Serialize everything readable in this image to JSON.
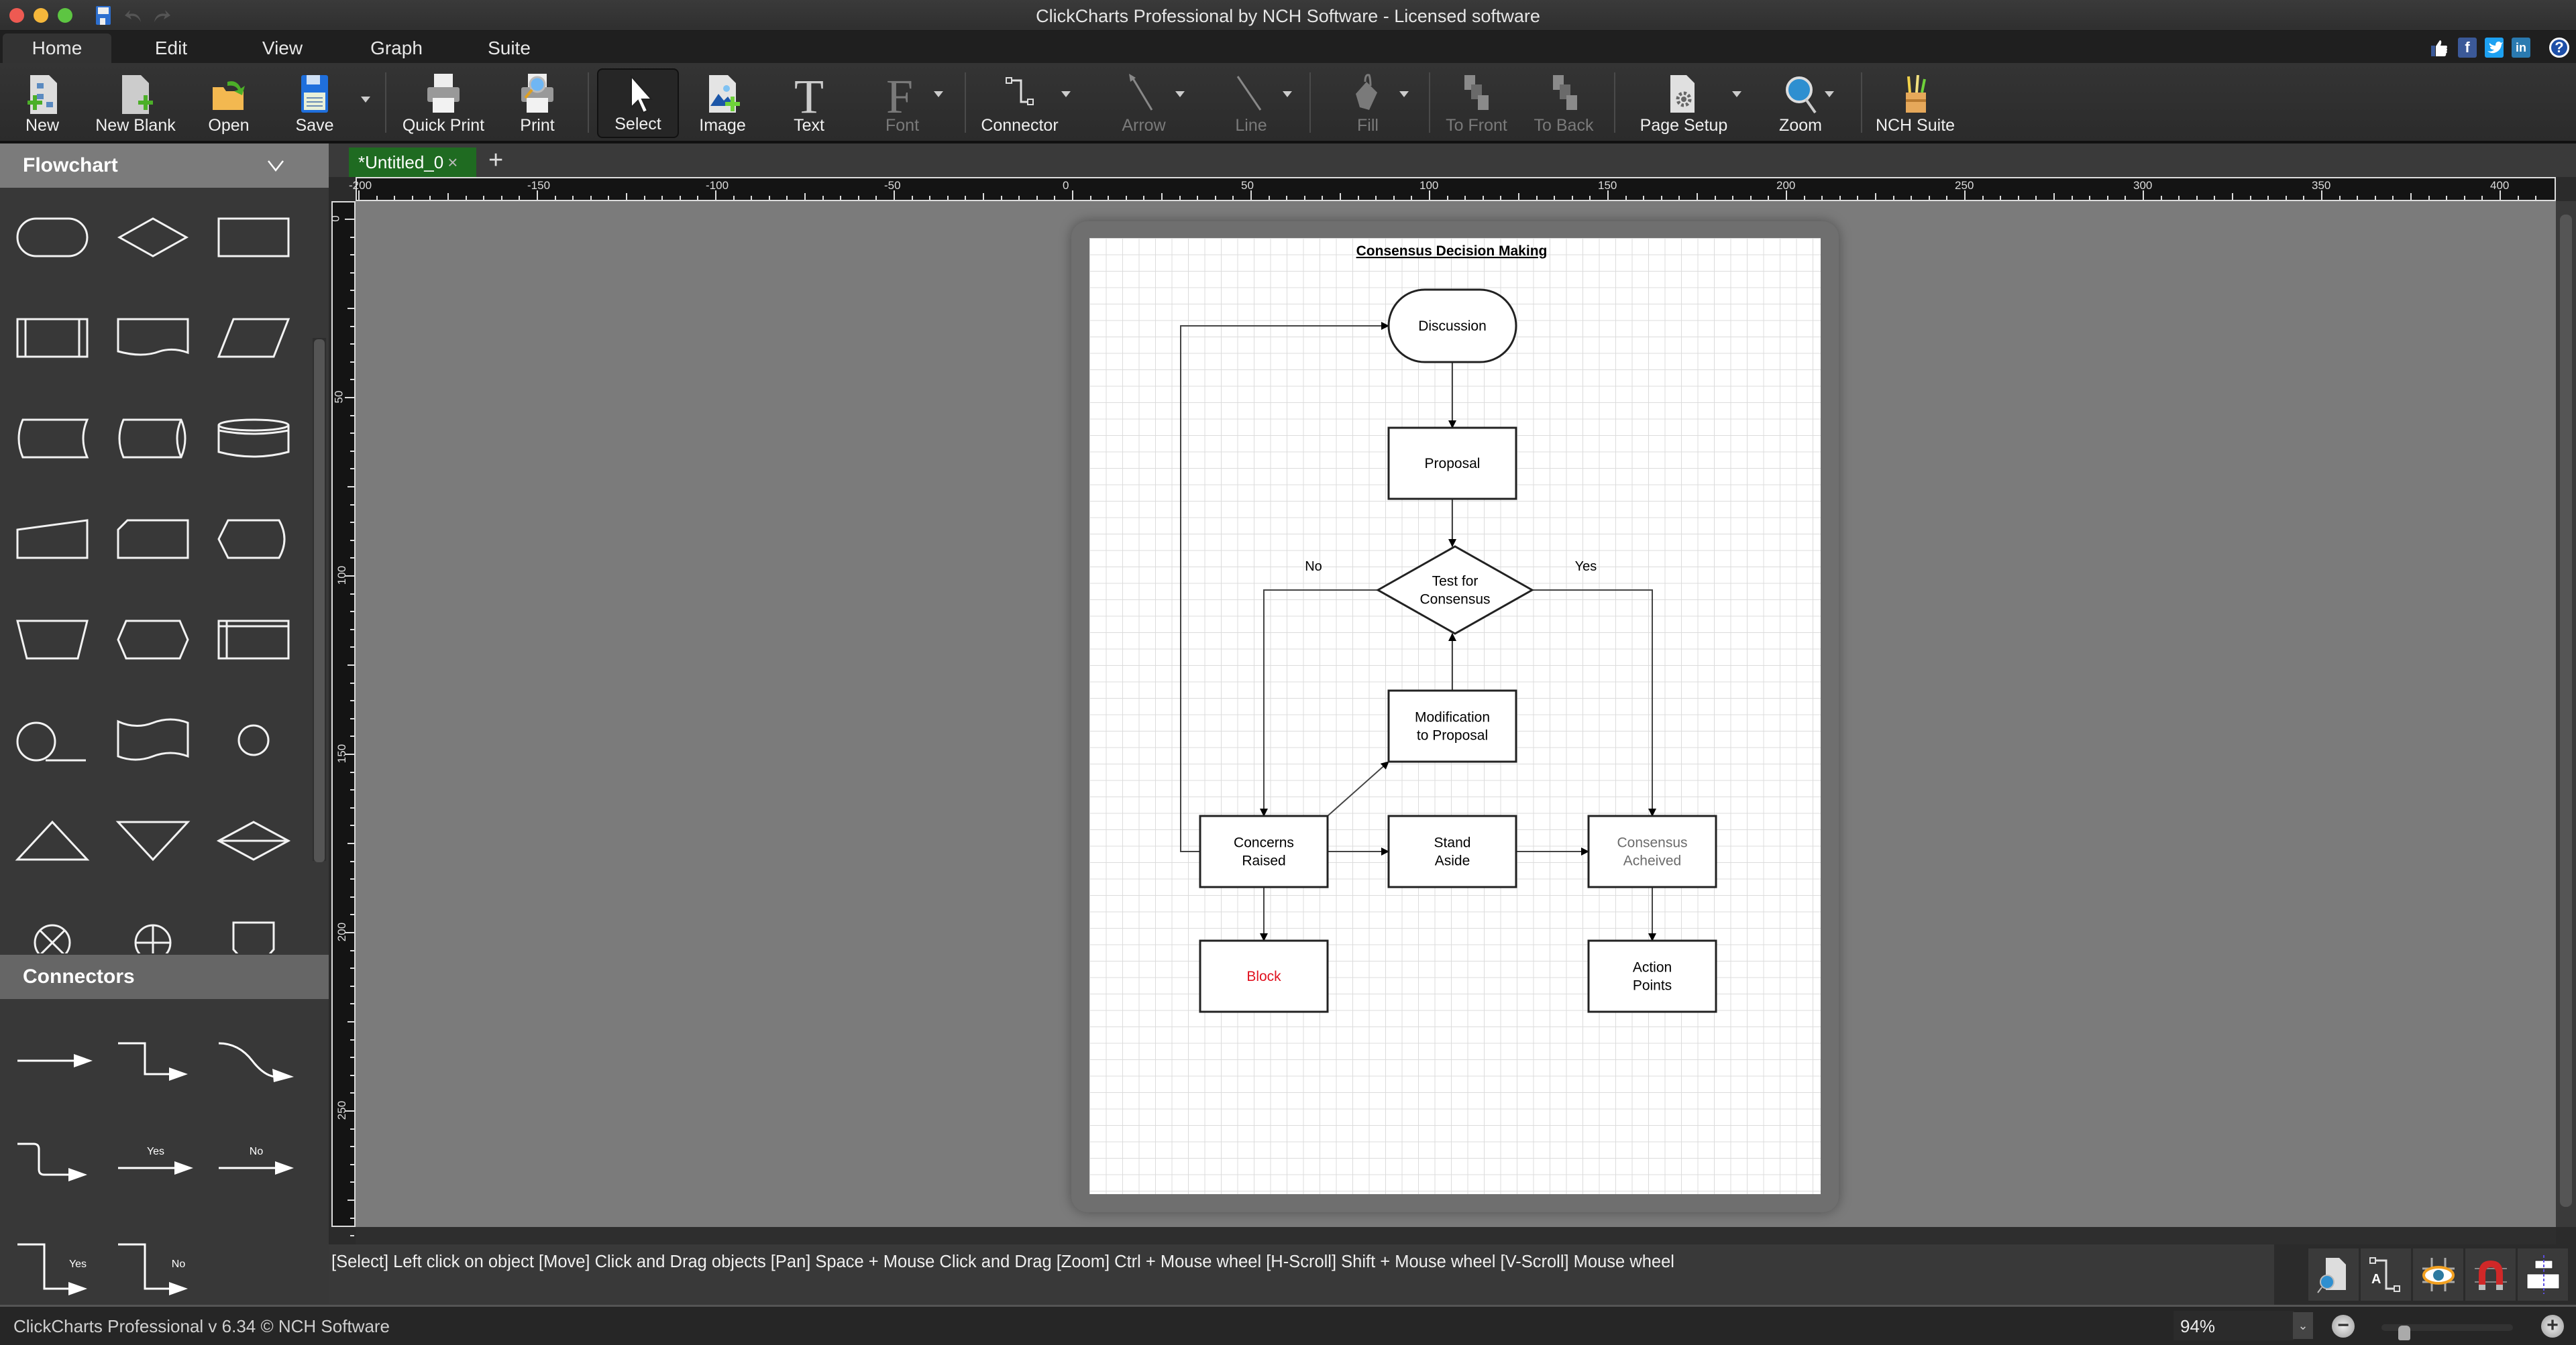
{
  "window": {
    "title": "ClickCharts Professional by NCH Software - Licensed software",
    "traffic_lights": [
      "#ee5a52",
      "#f5b73b",
      "#5dc542"
    ],
    "quick_icons": [
      "save-icon",
      "undo-icon",
      "redo-icon"
    ]
  },
  "menu": {
    "tabs": [
      {
        "label": "Home",
        "active": true
      },
      {
        "label": "Edit",
        "active": false
      },
      {
        "label": "View",
        "active": false
      },
      {
        "label": "Graph",
        "active": false
      },
      {
        "label": "Suite",
        "active": false
      }
    ],
    "social": [
      {
        "name": "like-icon",
        "glyph": "👍"
      },
      {
        "name": "facebook-icon",
        "glyph": "f"
      },
      {
        "name": "twitter-icon",
        "glyph": "t"
      },
      {
        "name": "linkedin-icon",
        "glyph": "in"
      },
      {
        "name": "help-icon",
        "glyph": "?"
      }
    ]
  },
  "toolbar": {
    "new": "New",
    "new_blank": "New Blank",
    "open": "Open",
    "save": "Save",
    "quick_print": "Quick Print",
    "print": "Print",
    "select": "Select",
    "image": "Image",
    "text": "Text",
    "font": "Font",
    "connector": "Connector",
    "arrow": "Arrow",
    "line": "Line",
    "fill": "Fill",
    "to_front": "To Front",
    "to_back": "To Back",
    "page_setup": "Page Setup",
    "zoom": "Zoom",
    "nch_suite": "NCH Suite"
  },
  "sidebar": {
    "flowchart_header": "Flowchart",
    "connectors_header": "Connectors",
    "shapes": [
      "terminator",
      "decision",
      "process",
      "predefined-process",
      "document",
      "data",
      "stored-data",
      "direct-access-storage",
      "database",
      "manual-input",
      "card",
      "display",
      "manual-operation",
      "preparation",
      "internal-storage",
      "sequential-data",
      "punched-tape",
      "connector",
      "extract",
      "merge",
      "collate",
      "summing-junction",
      "or",
      "off-page-connector"
    ],
    "connectors": [
      {
        "name": "straight-arrow",
        "label": ""
      },
      {
        "name": "elbow-arrow",
        "label": ""
      },
      {
        "name": "curved-arrow",
        "label": ""
      },
      {
        "name": "rounded-elbow-arrow",
        "label": ""
      },
      {
        "name": "yes-arrow",
        "label": "Yes"
      },
      {
        "name": "no-arrow",
        "label": "No"
      },
      {
        "name": "yes-elbow-arrow",
        "label": "Yes"
      },
      {
        "name": "no-elbow-arrow",
        "label": "No"
      }
    ]
  },
  "document": {
    "tab_label": "*Untitled_0",
    "tab_close": "×",
    "add_tab": "+",
    "ruler_h_labels": [
      "-200",
      "-150",
      "-100",
      "-50",
      "0",
      "50",
      "100",
      "150",
      "200",
      "250",
      "300",
      "350",
      "400"
    ],
    "ruler_v_labels": [
      "0",
      "50",
      "100",
      "150",
      "200",
      "250"
    ]
  },
  "diagram": {
    "title": "Consensus Decision Making",
    "nodes": [
      {
        "id": "discussion",
        "shape": "terminator",
        "lines": [
          "Discussion"
        ],
        "color": "#000000"
      },
      {
        "id": "proposal",
        "shape": "process",
        "lines": [
          "Proposal"
        ],
        "color": "#000000"
      },
      {
        "id": "test",
        "shape": "decision",
        "lines": [
          "Test for",
          "Consensus"
        ],
        "color": "#000000"
      },
      {
        "id": "modification",
        "shape": "process",
        "lines": [
          "Modification",
          "to Proposal"
        ],
        "color": "#000000"
      },
      {
        "id": "concerns",
        "shape": "process",
        "lines": [
          "Concerns",
          "Raised"
        ],
        "color": "#000000"
      },
      {
        "id": "stand",
        "shape": "process",
        "lines": [
          "Stand",
          "Aside"
        ],
        "color": "#000000"
      },
      {
        "id": "achieved",
        "shape": "process",
        "lines": [
          "Consensus",
          "Acheived"
        ],
        "color": "#6b6b6b"
      },
      {
        "id": "block",
        "shape": "process",
        "lines": [
          "Block"
        ],
        "color": "#e0101e"
      },
      {
        "id": "action",
        "shape": "process",
        "lines": [
          "Action",
          "Points"
        ],
        "color": "#000000"
      }
    ],
    "edge_labels": {
      "no": "No",
      "yes": "Yes"
    },
    "edges": [
      {
        "from": "discussion",
        "to": "proposal"
      },
      {
        "from": "proposal",
        "to": "test"
      },
      {
        "from": "test",
        "to": "concerns",
        "label": "No"
      },
      {
        "from": "test",
        "to": "achieved",
        "label": "Yes"
      },
      {
        "from": "modification",
        "to": "test"
      },
      {
        "from": "concerns",
        "to": "modification"
      },
      {
        "from": "concerns",
        "to": "stand"
      },
      {
        "from": "stand",
        "to": "achieved"
      },
      {
        "from": "concerns",
        "to": "block"
      },
      {
        "from": "achieved",
        "to": "action"
      },
      {
        "from": "concerns",
        "to": "discussion"
      }
    ]
  },
  "hints": {
    "text": "[Select] Left click on object  [Move] Click and Drag objects  [Pan] Space + Mouse Click and Drag  [Zoom] Ctrl + Mouse wheel  [H-Scroll] Shift + Mouse wheel  [V-Scroll] Mouse wheel"
  },
  "bottom_tools": [
    "find-page-icon",
    "auto-connector-text-icon",
    "show-grid-icon",
    "snap-to-grid-icon",
    "align-guides-icon"
  ],
  "status": {
    "version": "ClickCharts Professional v 6.34 © NCH Software",
    "zoom_value": "94%",
    "zoom_dropdown": "⌄",
    "zoom_out": "−",
    "zoom_in": "+",
    "zoom_level_percent": 94
  }
}
